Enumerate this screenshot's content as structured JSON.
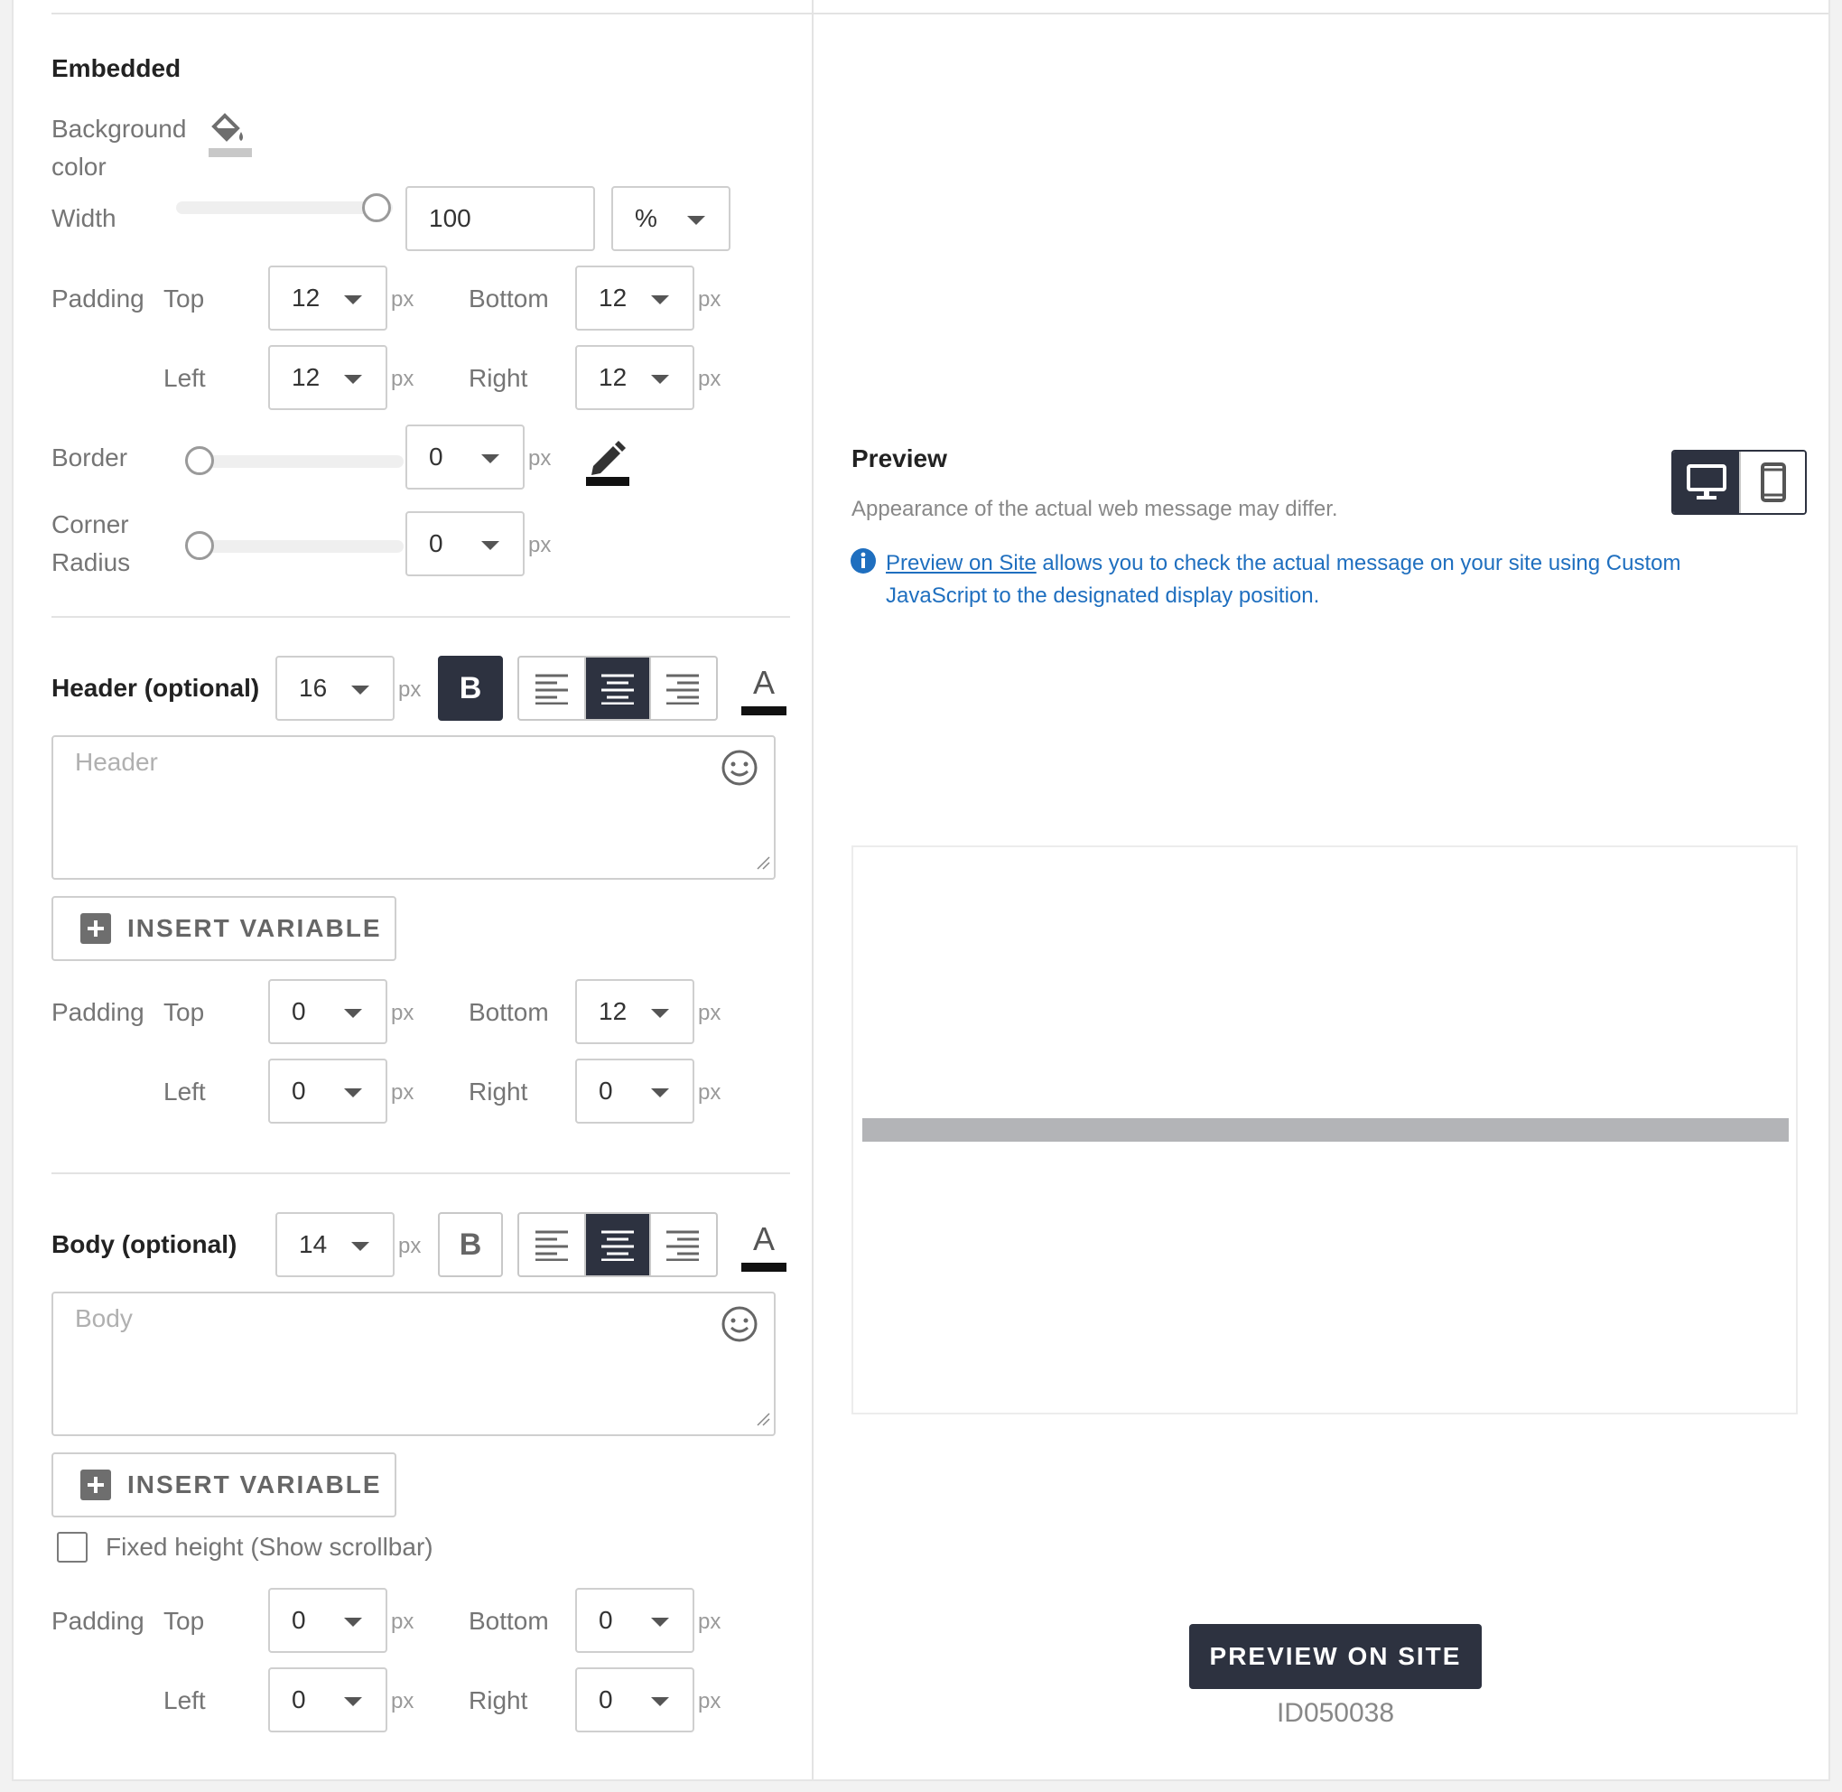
{
  "embedded": {
    "title": "Embedded",
    "background_color_label_1": "Background",
    "background_color_label_2": "color",
    "width_label": "Width",
    "width_value": "100",
    "width_slider_level": 100,
    "width_unit": "%",
    "padding_label": "Padding",
    "top_label": "Top",
    "bottom_label": "Bottom",
    "left_label": "Left",
    "right_label": "Right",
    "unit_px": "px",
    "padding_top": "12",
    "padding_bottom": "12",
    "padding_left": "12",
    "padding_right": "12",
    "border_label": "Border",
    "border_value": "0",
    "corner_label_1": "Corner",
    "corner_label_2": "Radius",
    "corner_value": "0"
  },
  "header": {
    "title": "Header (optional)",
    "font_size": "16",
    "bold_label": "B",
    "bold_on": true,
    "align_selected": "center",
    "color_label": "A",
    "placeholder": "Header",
    "insert_variable": "INSERT VARIABLE",
    "padding_top": "0",
    "padding_bottom": "12",
    "padding_left": "0",
    "padding_right": "0"
  },
  "body": {
    "title": "Body (optional)",
    "font_size": "14",
    "bold_label": "B",
    "bold_on": false,
    "align_selected": "center",
    "color_label": "A",
    "placeholder": "Body",
    "insert_variable": "INSERT VARIABLE",
    "fixed_height_label": "Fixed height (Show scrollbar)",
    "padding_top": "0",
    "padding_bottom": "0",
    "padding_left": "0",
    "padding_right": "0"
  },
  "preview": {
    "title": "Preview",
    "note": "Appearance of the actual web message may differ.",
    "info_link": "Preview on Site",
    "info_text_1": " allows you to check the actual message on your site using Custom",
    "info_text_2": "JavaScript to the designated display position.",
    "device_selected": "desktop",
    "preview_on_site_button": "PREVIEW ON SITE",
    "id": "ID050038"
  },
  "colors": {
    "dark": "#2d3240",
    "link": "#1f6fbf",
    "preview_bar": "#b3b4b7"
  }
}
